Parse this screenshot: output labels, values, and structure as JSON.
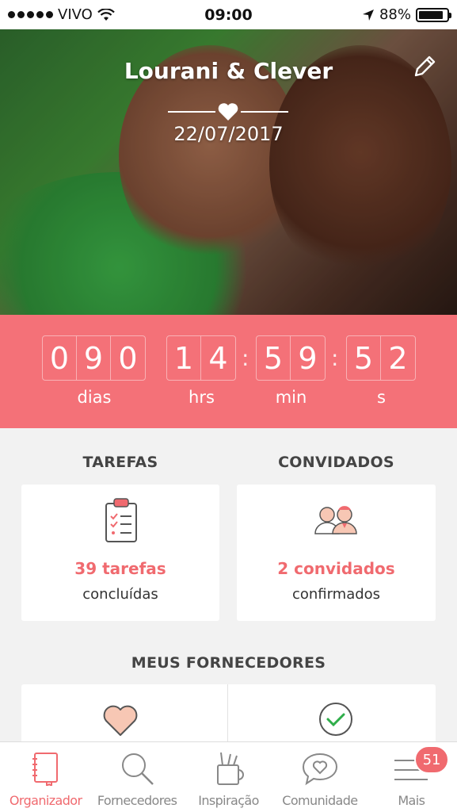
{
  "status_bar": {
    "carrier": "VIVO",
    "time": "09:00",
    "battery": "88%",
    "battery_level": 0.88
  },
  "hero": {
    "names": "Lourani & Clever",
    "date": "22/07/2017"
  },
  "countdown": {
    "days_digits": [
      "0",
      "9",
      "0"
    ],
    "hours_digits": [
      "1",
      "4"
    ],
    "minutes_digits": [
      "5",
      "9"
    ],
    "seconds_digits": [
      "5",
      "2"
    ],
    "labels": {
      "days": "dias",
      "hours": "hrs",
      "minutes": "min",
      "seconds": "s"
    },
    "separator": ":"
  },
  "tasks": {
    "title": "TAREFAS",
    "count": "39 tarefas",
    "sub": "concluídas"
  },
  "guests": {
    "title": "CONVIDADOS",
    "count": "2 convidados",
    "sub": "confirmados"
  },
  "vendors": {
    "title": "MEUS FORNECEDORES"
  },
  "tabbar": {
    "items": [
      {
        "label": "Organizador",
        "icon": "notebook-icon"
      },
      {
        "label": "Fornecedores",
        "icon": "search-icon"
      },
      {
        "label": "Inspiração",
        "icon": "tools-cup-icon"
      },
      {
        "label": "Comunidade",
        "icon": "chat-heart-icon"
      },
      {
        "label": "Mais",
        "icon": "menu-icon"
      }
    ],
    "badge": "51"
  },
  "colors": {
    "accent": "#f47178",
    "accent_text": "#f06a6f",
    "background": "#f2f2f2"
  }
}
